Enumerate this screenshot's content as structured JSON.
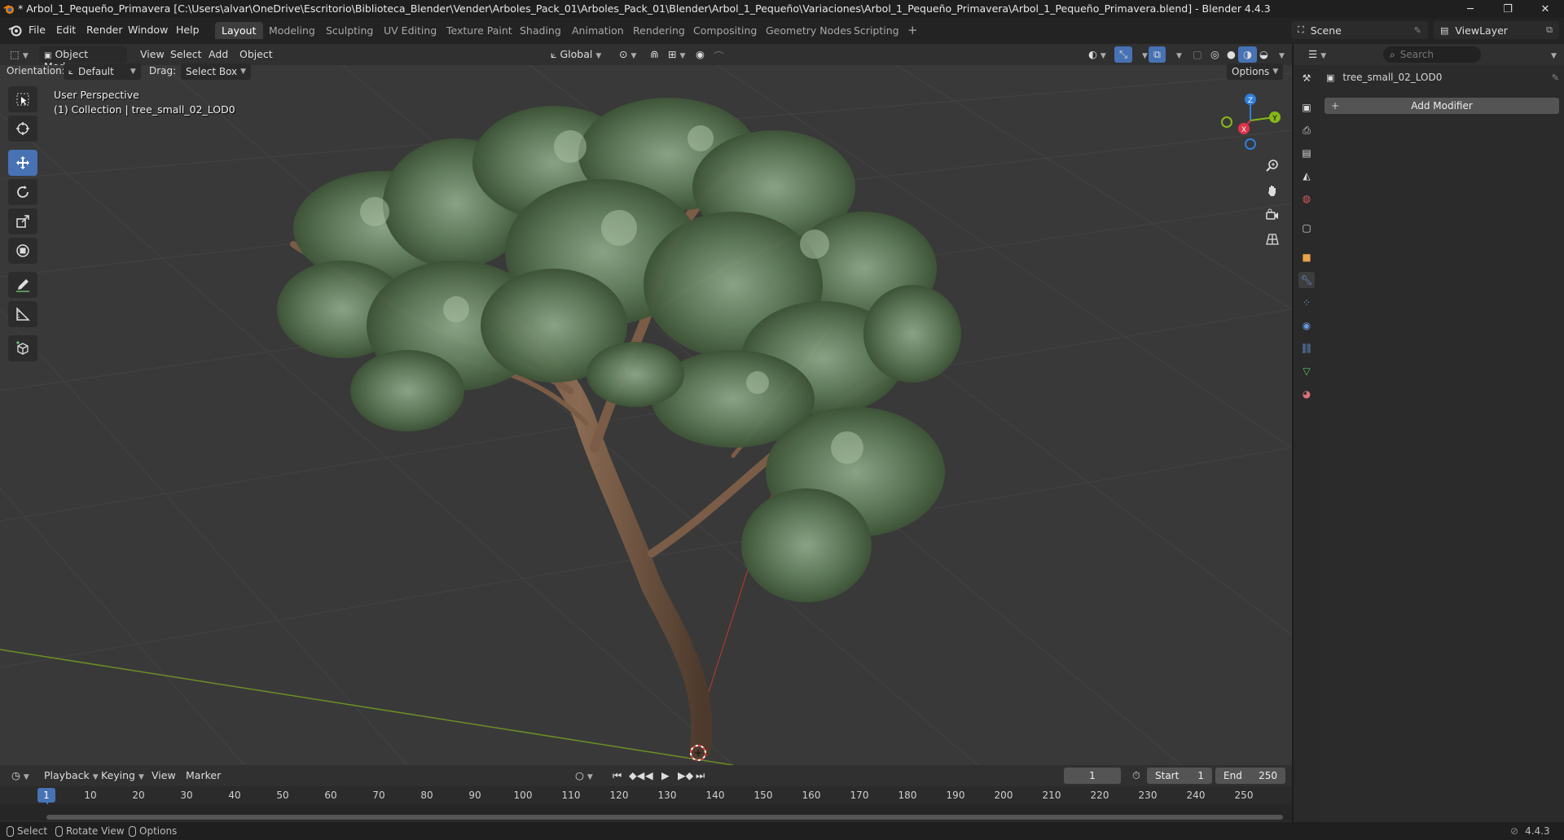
{
  "window": {
    "title": "* Arbol_1_Pequeño_Primavera [C:\\Users\\alvar\\OneDrive\\Escritorio\\Biblioteca_Blender\\Vender\\Arboles_Pack_01\\Arboles_Pack_01\\Blender\\Arbol_1_Pequeño\\Variaciones\\Arbol_1_Pequeño_Primavera\\Arbol_1_Pequeño_Primavera.blend] - Blender 4.4.3",
    "minimize": "─",
    "restore": "❐",
    "close": "✕"
  },
  "menu": {
    "items": [
      "File",
      "Edit",
      "Render",
      "Window",
      "Help"
    ]
  },
  "workspaces": {
    "tabs": [
      "Layout",
      "Modeling",
      "Sculpting",
      "UV Editing",
      "Texture Paint",
      "Shading",
      "Animation",
      "Rendering",
      "Compositing",
      "Geometry Nodes",
      "Scripting"
    ],
    "active": "Layout",
    "add": "+"
  },
  "scene": {
    "label": "Scene",
    "view_layer": "ViewLayer"
  },
  "viewport_header": {
    "mode": "Object Mode",
    "menus": [
      "View",
      "Select",
      "Add",
      "Object"
    ],
    "transform_orientation": "Global"
  },
  "tool_settings": {
    "orientation_label": "Orientation:",
    "orientation_value": "Default",
    "drag_label": "Drag:",
    "drag_value": "Select Box",
    "options": "Options"
  },
  "viewport": {
    "perspective": "User Perspective",
    "collection_info": "(1) Collection | tree_small_02_LOD0",
    "gizmo_axes": {
      "z": "Z",
      "y": "Y",
      "x": "X"
    },
    "colors": {
      "x_axis": "#e0334b",
      "y_axis": "#86b71b",
      "z_axis": "#2f7fdb"
    }
  },
  "properties": {
    "search_placeholder": "Search",
    "object_name": "tree_small_02_LOD0",
    "add_modifier": "Add Modifier"
  },
  "timeline": {
    "menus": [
      "Playback",
      "Keying",
      "View",
      "Marker"
    ],
    "current_frame": "1",
    "start_label": "Start",
    "start_value": "1",
    "end_label": "End",
    "end_value": "250",
    "frame_marks": [
      "10",
      "20",
      "30",
      "40",
      "50",
      "60",
      "70",
      "80",
      "90",
      "100",
      "110",
      "120",
      "130",
      "140",
      "150",
      "160",
      "170",
      "180",
      "190",
      "200",
      "210",
      "220",
      "230",
      "240",
      "250"
    ],
    "playhead": "1"
  },
  "statusbar": {
    "select": "Select",
    "rotate": "Rotate View",
    "options": "Options",
    "version": "4.4.3"
  }
}
